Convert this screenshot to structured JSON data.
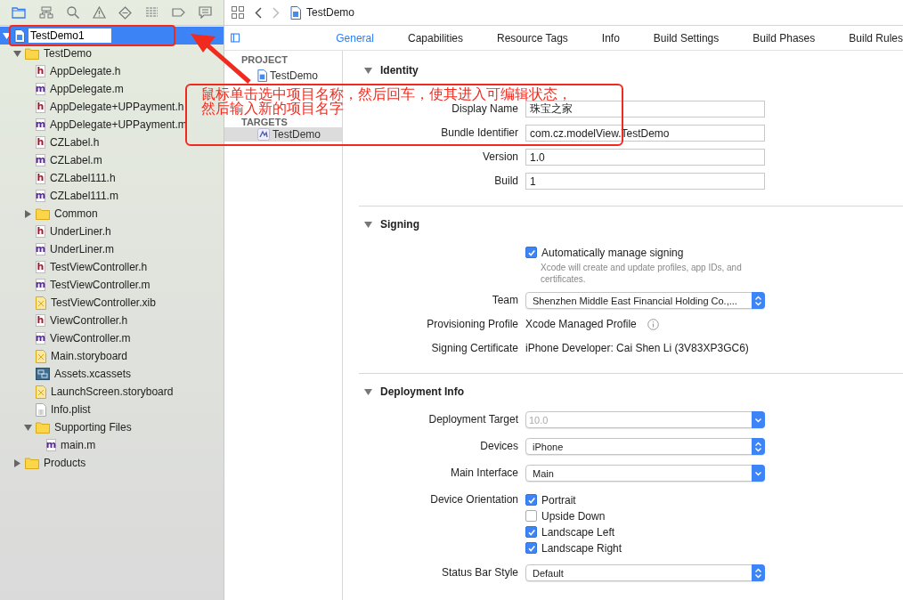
{
  "navigator": {
    "tree": [
      {
        "name": "TestDemo1",
        "kind": "project",
        "expanded": true,
        "selected": true,
        "editing": true,
        "children": [
          {
            "name": "TestDemo",
            "kind": "folder",
            "expanded": true,
            "selected": false,
            "children": [
              {
                "name": "AppDelegate.h",
                "kind": "source",
                "icon_letter": "h",
                "selected": false
              },
              {
                "name": "AppDelegate.m",
                "kind": "source",
                "icon_letter": "m",
                "selected": false
              },
              {
                "name": "AppDelegate+UPPayment.h",
                "kind": "source",
                "icon_letter": "h",
                "selected": false
              },
              {
                "name": "AppDelegate+UPPayment.m",
                "kind": "source",
                "icon_letter": "m",
                "selected": false
              },
              {
                "name": "CZLabel.h",
                "kind": "source",
                "icon_letter": "h",
                "selected": false
              },
              {
                "name": "CZLabel.m",
                "kind": "source",
                "icon_letter": "m",
                "selected": false
              },
              {
                "name": "CZLabel111.h",
                "kind": "source",
                "icon_letter": "h",
                "selected": false
              },
              {
                "name": "CZLabel111.m",
                "kind": "source",
                "icon_letter": "m",
                "selected": false
              },
              {
                "name": "Common",
                "kind": "folder",
                "expanded": false,
                "selected": false
              },
              {
                "name": "UnderLiner.h",
                "kind": "source",
                "icon_letter": "h",
                "selected": false
              },
              {
                "name": "UnderLiner.m",
                "kind": "source",
                "icon_letter": "m",
                "selected": false
              },
              {
                "name": "TestViewController.h",
                "kind": "source",
                "icon_letter": "h",
                "selected": false
              },
              {
                "name": "TestViewController.m",
                "kind": "source",
                "icon_letter": "m",
                "selected": false
              },
              {
                "name": "TestViewController.xib",
                "kind": "interface",
                "selected": false
              },
              {
                "name": "ViewController.h",
                "kind": "source",
                "icon_letter": "h",
                "selected": false
              },
              {
                "name": "ViewController.m",
                "kind": "source",
                "icon_letter": "m",
                "selected": false
              },
              {
                "name": "Main.storyboard",
                "kind": "interface",
                "selected": false
              },
              {
                "name": "Assets.xcassets",
                "kind": "assets",
                "selected": false
              },
              {
                "name": "LaunchScreen.storyboard",
                "kind": "interface",
                "selected": false
              },
              {
                "name": "Info.plist",
                "kind": "plist",
                "selected": false
              },
              {
                "name": "Supporting Files",
                "kind": "folder",
                "expanded": true,
                "selected": false,
                "children": [
                  {
                    "name": "main.m",
                    "kind": "source",
                    "icon_letter": "m",
                    "selected": false
                  }
                ]
              }
            ]
          },
          {
            "name": "Products",
            "kind": "folder",
            "expanded": false,
            "selected": false
          }
        ]
      }
    ]
  },
  "breadcrumb": "TestDemo",
  "tabs": [
    {
      "label": "General",
      "selected": true
    },
    {
      "label": "Capabilities",
      "selected": false
    },
    {
      "label": "Resource Tags",
      "selected": false
    },
    {
      "label": "Info",
      "selected": false
    },
    {
      "label": "Build Settings",
      "selected": false
    },
    {
      "label": "Build Phases",
      "selected": false
    },
    {
      "label": "Build Rules",
      "selected": false
    }
  ],
  "targets_list": [
    {
      "heading": "PROJECT",
      "items": [
        {
          "label": "TestDemo",
          "kind": "project",
          "selected": false
        }
      ]
    },
    {
      "heading": "TARGETS",
      "items": [
        {
          "label": "TestDemo",
          "kind": "app",
          "selected": true
        }
      ]
    }
  ],
  "sections": [
    {
      "title": "Identity",
      "expanded": true,
      "rows": [
        {
          "kind": "field",
          "label": "Display Name",
          "value": "珠宝之家"
        },
        {
          "kind": "field",
          "label": "Bundle Identifier",
          "value": "com.cz.modelView.TestDemo"
        },
        {
          "kind": "field",
          "label": "Version",
          "value": "1.0"
        },
        {
          "kind": "field",
          "label": "Build",
          "value": "1"
        }
      ]
    },
    {
      "title": "Signing",
      "expanded": true,
      "rows": [
        {
          "kind": "check",
          "options": [
            {
              "text": "Automatically manage signing",
              "checked": true
            }
          ],
          "note": "Xcode will create and update profiles, app IDs, and certificates."
        },
        {
          "kind": "select",
          "label": "Team",
          "value": "Shenzhen Middle East Financial Holding Co.,...",
          "stepper": true,
          "disabled": false
        },
        {
          "kind": "static",
          "label": "Provisioning Profile",
          "value": "Xcode Managed Profile",
          "info": true
        },
        {
          "kind": "static",
          "label": "Signing Certificate",
          "value": "iPhone Developer: Cai Shen Li (3V83XP3GC6)",
          "info": false
        }
      ]
    },
    {
      "title": "Deployment Info",
      "expanded": true,
      "rows": [
        {
          "kind": "select",
          "label": "Deployment Target",
          "value": "10.0",
          "stepper": false,
          "disabled": true
        },
        {
          "kind": "select",
          "label": "Devices",
          "value": "iPhone",
          "stepper": true,
          "disabled": false
        },
        {
          "kind": "select",
          "label": "Main Interface",
          "value": "Main",
          "stepper": false,
          "disabled": false
        },
        {
          "kind": "check",
          "label": "Device Orientation",
          "options": [
            {
              "text": "Portrait",
              "checked": true
            },
            {
              "text": "Upside Down",
              "checked": false
            },
            {
              "text": "Landscape Left",
              "checked": true
            },
            {
              "text": "Landscape Right",
              "checked": true
            }
          ]
        },
        {
          "kind": "select",
          "label": "Status Bar Style",
          "value": "Default",
          "stepper": true,
          "disabled": false
        }
      ]
    }
  ],
  "annotation": {
    "lines": [
      "鼠标单击选中项目名称，然后回车，使其进入可编辑状态，",
      "然后输入新的项目名字"
    ]
  }
}
